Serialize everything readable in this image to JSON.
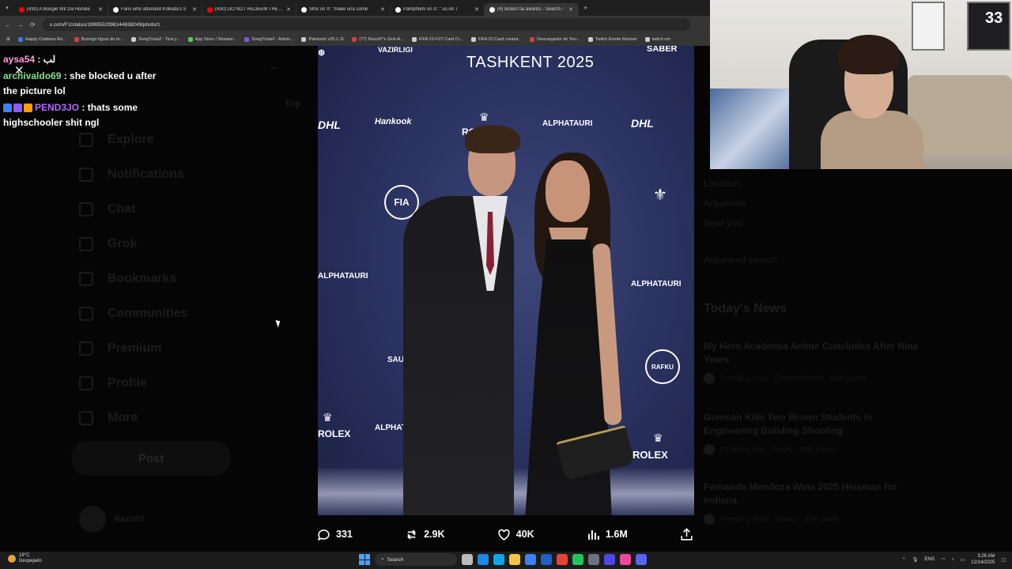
{
  "browser": {
    "tabs": [
      {
        "title": "(430) A Boogie Wit Da Hoodie",
        "color": "#ff0000",
        "active": false
      },
      {
        "title": "Fans who attended Kolkata's S",
        "color": "#ffffff",
        "active": false
      },
      {
        "title": "(430) DO NOT REDEEM THE CA",
        "color": "#ff0000",
        "active": false
      },
      {
        "title": "SKB on X: \"make una come",
        "color": "#ffffff",
        "active": false
      },
      {
        "title": "Pamphlets on X: \" us All T",
        "color": "#ffffff",
        "active": false
      },
      {
        "title": "(4) leclerc fia awards - Search /",
        "color": "#ffffff",
        "active": true
      }
    ],
    "url": "x.com/F1/status/1999552096144638249/photo/1",
    "bookmarks": [
      {
        "label": "Happy Cristiano Ro...",
        "color": "#3a7bd5"
      },
      {
        "label": "Burrego figure de to...",
        "color": "#d04040"
      },
      {
        "label": "SongTrivia2 - Test y...",
        "color": "#cccccc"
      },
      {
        "label": "App Store / Streami...",
        "color": "#5fc26a"
      },
      {
        "label": "SongTrivia2 - Adivin...",
        "color": "#7a5ad8"
      },
      {
        "label": "Paletools v25.1.11",
        "color": "#cccccc"
      },
      {
        "label": "(77) Razo97's Zest-A...",
        "color": "#d04040"
      },
      {
        "label": "FIFA 23 FUT Card Cr...",
        "color": "#cccccc"
      },
      {
        "label": "FIFA 23 Card creator...",
        "color": "#cccccc"
      },
      {
        "label": "Descargador de You...",
        "color": "#d04040"
      },
      {
        "label": "Twitch Emote Resizer",
        "color": "#cccccc"
      },
      {
        "label": "twitch em",
        "color": "#cccccc"
      }
    ]
  },
  "chat": {
    "messages": [
      {
        "user": "aysa54",
        "user_color": "#ff9ad6",
        "text": "لب",
        "badges": []
      },
      {
        "user": "archivaldo69",
        "user_color": "#7fe08a",
        "text": "she blocked u after the picture lol",
        "badges": []
      },
      {
        "user": "PEND3JO",
        "user_color": "#b268ff",
        "text": "thats some highschooler shit ngl",
        "badges": [
          "#3b82f6",
          "#8b5cf6",
          "#f59e0b"
        ]
      }
    ]
  },
  "x_sidebar": {
    "items": [
      "Explore",
      "Notifications",
      "Chat",
      "Grok",
      "Bookmarks",
      "Communities",
      "Premium",
      "Profile",
      "More"
    ],
    "post_label": "Post",
    "profile_name": "Razo97"
  },
  "x_right": {
    "location_label": "Location",
    "anywhere": "Anywhere",
    "near_you": "Near you",
    "advanced_search": "Advanced search",
    "news_heading": "Today's News",
    "news": [
      {
        "title": "My Hero Academia Anime Concludes After Nine Years",
        "meta": "Trending now · Entertainment · 64K posts"
      },
      {
        "title": "Gunman Kills Two Brown Students in Engineering Building Shooting",
        "meta": "13 hours ago · News · 30K posts"
      },
      {
        "title": "Fernando Mendoza Wins 2025 Heisman for Indiana",
        "meta": "Trending now · Sports · 38K posts"
      }
    ],
    "middle_tab": "Top"
  },
  "photo": {
    "event_title": "TASHKENT 2025",
    "sponsor_logos": [
      "VAZIRLIGI",
      "SABER",
      "DHL",
      "Hankook",
      "ROLEX",
      "ALPHATAURI",
      "FIA",
      "RAFKU",
      "SAUBER"
    ]
  },
  "actions": {
    "replies": "331",
    "reposts": "2.9K",
    "likes": "40K",
    "views": "1.6M"
  },
  "webcam": {
    "jersey_number": "33"
  },
  "taskbar": {
    "temperature": "18°C",
    "weather_label": "Despejado",
    "search_label": "Search",
    "language": "ENG",
    "time": "3:26 AM",
    "date": "12/14/2025",
    "app_colors": [
      "#bbbbbb",
      "#1e88e5",
      "#0ea5e9",
      "#f4c542",
      "#3b82f6",
      "#1e60c9",
      "#ea4335",
      "#22c55e",
      "#6b7280",
      "#4f46e5",
      "#ec4899",
      "#5865f2"
    ]
  }
}
